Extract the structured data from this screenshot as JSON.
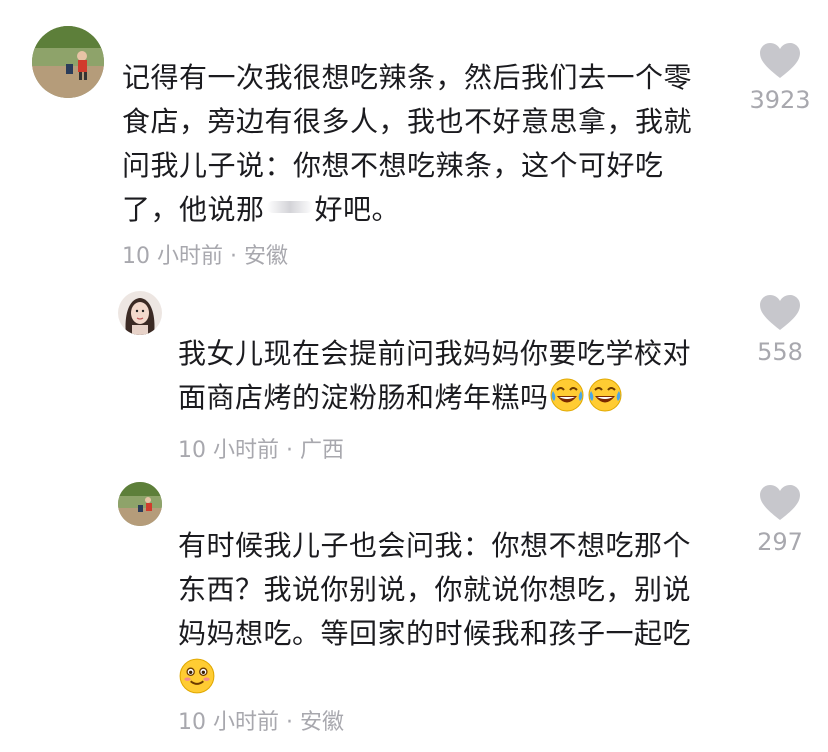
{
  "comments": [
    {
      "lines": [
        "记得有一次我很想吃辣条，然后我们去一个零",
        "食店，旁边有很多人，我也不好意思拿，我就",
        "问我儿子说：你想不想吃辣条，这个可好吃",
        "了，他说那",
        "好吧。"
      ],
      "meta": "10 小时前 · 安徽",
      "likes": "3923"
    },
    {
      "lines": [
        "我女儿现在会提前问我妈妈你要吃学校对",
        "面商店烤的淀粉肠和烤年糕吗"
      ],
      "emoji": [
        "laughing-tears-emoji",
        "laughing-tears-emoji"
      ],
      "meta": "10 小时前 · 广西",
      "likes": "558"
    },
    {
      "lines": [
        "有时候我儿子也会问我：你想不想吃那个",
        "东西？我说你别说，你就说你想吃，别说",
        "妈妈想吃。等回家的时候我和孩子一起吃"
      ],
      "emoji": [
        "blushing-smile-emoji"
      ],
      "meta": "10 小时前 · 安徽",
      "likes": "297"
    }
  ],
  "colors": {
    "text": "#1b1b1f",
    "meta": "#a8a8ae",
    "heart": "#c7c7cc"
  }
}
